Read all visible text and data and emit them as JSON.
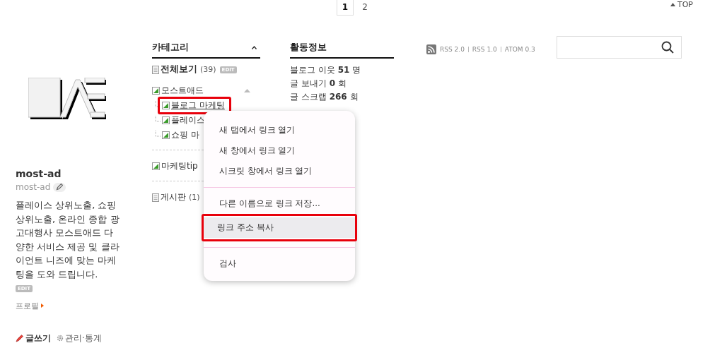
{
  "pager": [
    {
      "label": "1",
      "selected": true
    },
    {
      "label": "2",
      "selected": false
    }
  ],
  "top_link": "TOP",
  "profile": {
    "name": "most-ad",
    "id": "most-ad",
    "description": "플레이스 상위노출, 쇼핑 상위노출, 온라인 종합 광고대행사 모스트애드 다양한 서비스 제공 및 클라이언트 니즈에 맞는 마케팅을 도와 드립니다.",
    "edit_badge": "EDIT",
    "profile_link": "프로필",
    "write_link": "글쓰기",
    "admin_link": "관리·통계"
  },
  "category": {
    "title": "카테고리",
    "groups": [
      {
        "divider": false,
        "items": [
          {
            "kind": "total",
            "label": "전체보기",
            "count": "(39)",
            "badge": "EDIT",
            "highlighted": false
          }
        ]
      },
      {
        "divider": false,
        "items": [
          {
            "kind": "category",
            "label": "모스트애드",
            "expanded": true,
            "highlighted": false,
            "children": [
              {
                "kind": "category",
                "label": "블로그 마케팅",
                "highlighted": true
              },
              {
                "kind": "category",
                "label": "플레이스",
                "highlighted": false
              },
              {
                "kind": "category",
                "label": "쇼핑 마",
                "highlighted": false
              }
            ]
          }
        ]
      },
      {
        "divider": true,
        "items": [
          {
            "kind": "category",
            "label": "마케팅tip",
            "highlighted": false
          }
        ]
      },
      {
        "divider": true,
        "items": [
          {
            "kind": "board",
            "label": "게시판",
            "count": "(1)",
            "highlighted": false
          }
        ]
      }
    ]
  },
  "activity": {
    "title": "활동정보",
    "lines": [
      "블로그 이웃 **51** 명",
      "글 보내기 **0** 회",
      "글 스크랩 **266** 회"
    ]
  },
  "feeds": [
    "RSS 2.0",
    "RSS 1.0",
    "ATOM 0.3"
  ],
  "context_menu": [
    {
      "kind": "item",
      "label": "새 탭에서 링크 열기",
      "selected": false,
      "highlighted": false
    },
    {
      "kind": "item",
      "label": "새 창에서 링크 열기",
      "selected": false,
      "highlighted": false
    },
    {
      "kind": "item",
      "label": "시크릿 창에서 링크 열기",
      "selected": false,
      "highlighted": false
    },
    {
      "kind": "separator"
    },
    {
      "kind": "item",
      "label": "다른 이름으로 링크 저장...",
      "selected": false,
      "highlighted": false
    },
    {
      "kind": "item",
      "label": "링크 주소 복사",
      "selected": true,
      "highlighted": true
    },
    {
      "kind": "separator"
    },
    {
      "kind": "item",
      "label": "검사",
      "selected": false,
      "highlighted": false
    }
  ]
}
